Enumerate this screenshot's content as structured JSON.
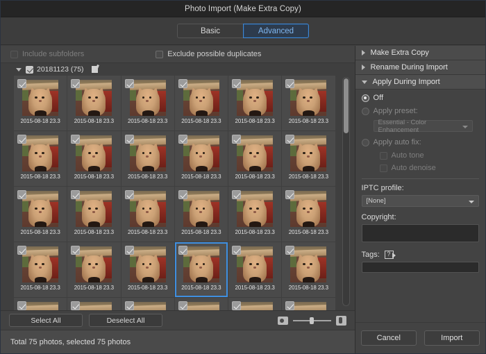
{
  "window": {
    "title": "Photo Import (Make Extra Copy)"
  },
  "tabs": [
    {
      "label": "Basic",
      "active": false
    },
    {
      "label": "Advanced",
      "active": true
    }
  ],
  "options": {
    "include_subfolders": {
      "label": "Include subfolders",
      "checked": false,
      "enabled": false
    },
    "exclude_duplicates": {
      "label": "Exclude possible duplicates",
      "checked": false,
      "enabled": true
    }
  },
  "folder": {
    "name": "20181123 (75)",
    "checked": true,
    "expanded": true,
    "edit_icon": "edit-note-icon"
  },
  "grid": {
    "columns": 6,
    "caption": "2015-08-18 23.3",
    "thumb_count": 30,
    "selected_index": 21,
    "all_checked": true
  },
  "scrollbar": {
    "position": "top",
    "thumb_size_pct": 24
  },
  "left_toolbar": {
    "select_all": "Select All",
    "deselect_all": "Deselect All",
    "small_icon": "small-thumbnail-icon",
    "large_icon": "large-thumbnail-icon",
    "slider_value": 45
  },
  "status": {
    "text": "Total 75 photos, selected 75 photos"
  },
  "right_panel": {
    "sections": [
      {
        "label": "Make Extra Copy",
        "expanded": false
      },
      {
        "label": "Rename During Import",
        "expanded": false
      },
      {
        "label": "Apply During Import",
        "expanded": true
      }
    ],
    "apply_during_import": {
      "mode": "off",
      "off": {
        "label": "Off",
        "selected": true
      },
      "apply_preset": {
        "label": "Apply preset:",
        "selected": false,
        "enabled": false
      },
      "preset_value": "Essential - Color Enhancement",
      "apply_auto_fix": {
        "label": "Apply auto fix:",
        "selected": false,
        "enabled": false
      },
      "auto_tone": {
        "label": "Auto tone",
        "checked": false,
        "enabled": false
      },
      "auto_denoise": {
        "label": "Auto denoise",
        "checked": false,
        "enabled": false
      },
      "iptc_label": "IPTC profile:",
      "iptc_value": "[None]",
      "copyright_label": "Copyright:",
      "copyright_value": "",
      "tags_label": "Tags:",
      "tags_value": "",
      "tags_icon": "tag-help-icon"
    }
  },
  "dialog_buttons": {
    "cancel": "Cancel",
    "import": "Import"
  },
  "colors": {
    "accent": "#3f8fe0",
    "window_bg": "#414141",
    "panel_bg": "#434343",
    "titlebar_bg": "#252525"
  }
}
